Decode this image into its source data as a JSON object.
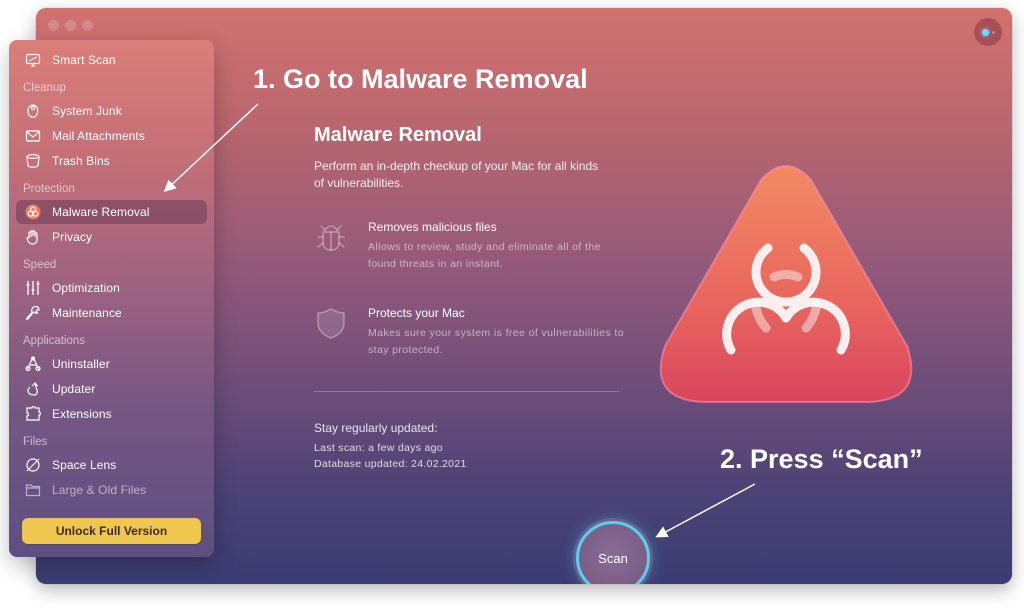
{
  "window": {
    "traffic_lights": [
      "close",
      "minimize",
      "zoom"
    ],
    "assistant_icon": "assistant-orb-icon"
  },
  "sidebar": {
    "items": [
      {
        "type": "item",
        "label": "Smart Scan",
        "icon": "monitor-scan-icon"
      },
      {
        "type": "section",
        "label": "Cleanup"
      },
      {
        "type": "item",
        "label": "System Junk",
        "icon": "system-junk-icon"
      },
      {
        "type": "item",
        "label": "Mail Attachments",
        "icon": "mail-icon"
      },
      {
        "type": "item",
        "label": "Trash Bins",
        "icon": "trash-bin-icon"
      },
      {
        "type": "section",
        "label": "Protection"
      },
      {
        "type": "item",
        "label": "Malware Removal",
        "icon": "biohazard-icon",
        "active": true
      },
      {
        "type": "item",
        "label": "Privacy",
        "icon": "hand-icon"
      },
      {
        "type": "section",
        "label": "Speed"
      },
      {
        "type": "item",
        "label": "Optimization",
        "icon": "sliders-icon"
      },
      {
        "type": "item",
        "label": "Maintenance",
        "icon": "wrench-icon"
      },
      {
        "type": "section",
        "label": "Applications"
      },
      {
        "type": "item",
        "label": "Uninstaller",
        "icon": "uninstaller-icon"
      },
      {
        "type": "item",
        "label": "Updater",
        "icon": "update-arrow-icon"
      },
      {
        "type": "item",
        "label": "Extensions",
        "icon": "puzzle-icon"
      },
      {
        "type": "section",
        "label": "Files"
      },
      {
        "type": "item",
        "label": "Space Lens",
        "icon": "planet-icon"
      },
      {
        "type": "item",
        "label": "Large & Old Files",
        "icon": "folder-icon",
        "dim": true
      }
    ],
    "unlock_label": "Unlock Full Version"
  },
  "main": {
    "title": "Malware Removal",
    "description": "Perform an in-depth checkup of your Mac for all kinds of vulnerabilities.",
    "features": [
      {
        "icon": "bug-icon",
        "title": "Removes malicious files",
        "desc": "Allows to review, study and eliminate all of the found threats in an instant."
      },
      {
        "icon": "shield-icon",
        "title": "Protects your Mac",
        "desc": "Makes sure your system is free of vulnerabilities to stay protected."
      }
    ],
    "update_heading": "Stay regularly updated:",
    "last_scan": "Last scan: a few days ago",
    "database_updated": "Database updated: 24.02.2021",
    "scan_label": "Scan",
    "hero_icon": "biohazard-triangle-icon"
  },
  "annotations": {
    "step1": "1. Go to Malware Removal",
    "step2": "2. Press “Scan”"
  },
  "colors": {
    "unlock_button": "#efc74e",
    "scan_ring": "#5cd0ea",
    "hero_triangle_top": "#f28a62",
    "hero_triangle_bottom": "#d9455e"
  }
}
